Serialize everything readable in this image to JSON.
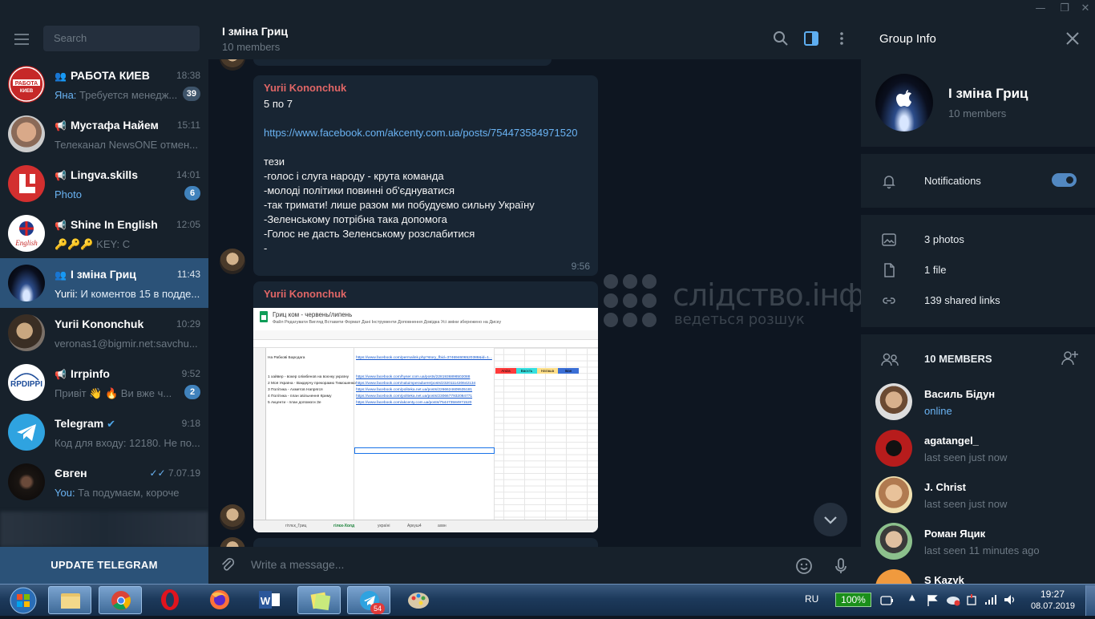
{
  "window": {
    "minimize": "—",
    "maximize": "❐",
    "close": "✕"
  },
  "sidebar": {
    "search_placeholder": "Search",
    "chats": [
      {
        "name": "РАБОТА КИЕВ",
        "type": "group",
        "time": "18:38",
        "sender": "Яна:",
        "preview": " Требуется менедж...",
        "badge": "39",
        "badge_muted": true
      },
      {
        "name": "Мустафа Найем",
        "type": "channel",
        "time": "15:11",
        "sender": "",
        "preview": "Телеканал NewsONE отмен...",
        "badge": ""
      },
      {
        "name": "Lingva.skills",
        "type": "channel",
        "time": "14:01",
        "sender": "Photo",
        "preview": "",
        "badge": "6",
        "badge_muted": false
      },
      {
        "name": "Shine In English",
        "type": "channel",
        "time": "12:05",
        "sender": "",
        "preview": "🔑🔑🔑 KEY: C",
        "badge": ""
      },
      {
        "name": "І зміна Гриц",
        "type": "group",
        "time": "11:43",
        "sender": "Yurii:",
        "preview": " И коментов 15 в подде...",
        "badge": "",
        "active": true
      },
      {
        "name": "Yurii Kononchuk",
        "type": "user",
        "time": "10:29",
        "sender": "",
        "preview": "veronas1@bigmir.net:savchu...",
        "badge": ""
      },
      {
        "name": "Irrpinfo",
        "type": "channel",
        "time": "9:52",
        "sender": "",
        "preview": "Привіт 👋  🔥 Ви вже ч...",
        "badge": "2",
        "badge_muted": false
      },
      {
        "name": "Telegram",
        "type": "user",
        "time": "9:18",
        "sender": "",
        "preview": "Код для входу: 12180. Не по...",
        "badge": "",
        "verified": true
      },
      {
        "name": "Євген",
        "type": "user",
        "time": "7.07.19",
        "sender": "You:",
        "preview": " Та подумаєм, короче",
        "badge": "",
        "read": true
      }
    ],
    "update_label": "UPDATE TELEGRAM"
  },
  "chat": {
    "title": "І зміна Гриц",
    "subtitle": "10 members",
    "messages": [
      {
        "author": "Yurii Kononchuk",
        "line1": "5 по 7",
        "link": "https://www.facebook.com/akcenty.com.ua/posts/754473584971520",
        "body": "тези\n-голос і слуга народу - крута команда\n-молоді політики повинні об'єднуватися\n-так тримати! лише разом ми побудуємо сильну Україну\n-Зеленському потрібна така допомога\n-Голос не дасть Зеленському розслабитися\n-",
        "time": "9:56"
      },
      {
        "author": "Yurii Kononchuk",
        "sheet": {
          "title": "Гриц ком - червень/липень",
          "menu": "Файл   Редагувати   Вигляд   Вставити   Формат   Дані   Інструменти   Доповнення   Довідка    Усі зміни збережено на Диску",
          "a38": "На Рабкові Барєдага",
          "b38": "https://www.facebook.com/permalink.php?story_fbid=374694606520388&id=1...",
          "tags": [
            "Aniza",
            "Васєть",
            "Наташа",
            "Іван"
          ],
          "rows": [
            {
              "a": "1 хайвер - вокер олімбенов на воєнку україну",
              "b": "https://www.facebook.com/hyser.com.ua/posts/2281936898502088"
            },
            {
              "a": "2 Моя Україна - Вакдерчу прекорамю Тимошенко",
              "b": "https://www.facebook.com/naluimperaduere/posts/2320111420642134"
            },
            {
              "a": "3 Політика - Ахметов Напрягся",
              "b": "https://www.facebook.com/politeka.net.ua/posts/2266624609535181"
            },
            {
              "a": "4 Політика - план звільнення Криму",
              "b": "https://www.facebook.com/politeka.net.ua/posts/2306677932084771"
            },
            {
              "a": "5 Акценти - план допомоги Зе",
              "b": "https://www.facebook.com/akcenty.com.ua/posts/754473584971520"
            }
          ],
          "tabs": [
            "гітлєк_Гриц",
            "гілєк-Холд",
            "україні",
            "Аркуш4",
            "ахвн"
          ]
        }
      }
    ],
    "watermark_title": "слідство.інфо",
    "watermark_sub": "ведеться розшук",
    "composer_placeholder": "Write a message..."
  },
  "info": {
    "title": "Group Info",
    "group_name": "І зміна Гриц",
    "group_sub": "10 members",
    "notifications_label": "Notifications",
    "notifications_on": true,
    "photos": "3 photos",
    "files": "1 file",
    "links": "139 shared links",
    "members_title": "10 MEMBERS",
    "members": [
      {
        "name": "Василь Бідун",
        "status": "online"
      },
      {
        "name": "agatangel_",
        "status": "last seen just now"
      },
      {
        "name": "J. Christ",
        "status": "last seen just now"
      },
      {
        "name": "Роман Яцик",
        "status": "last seen 11 minutes ago"
      },
      {
        "name": "S Kazyk",
        "status": ""
      }
    ]
  },
  "taskbar": {
    "lang": "RU",
    "battery": "100%",
    "time": "19:27",
    "date": "08.07.2019",
    "telegram_badge": "54"
  },
  "colors": {
    "accent": "#5288c1",
    "active_chat": "#2b5278",
    "author": "#e06666",
    "link": "#6ab3f3"
  }
}
